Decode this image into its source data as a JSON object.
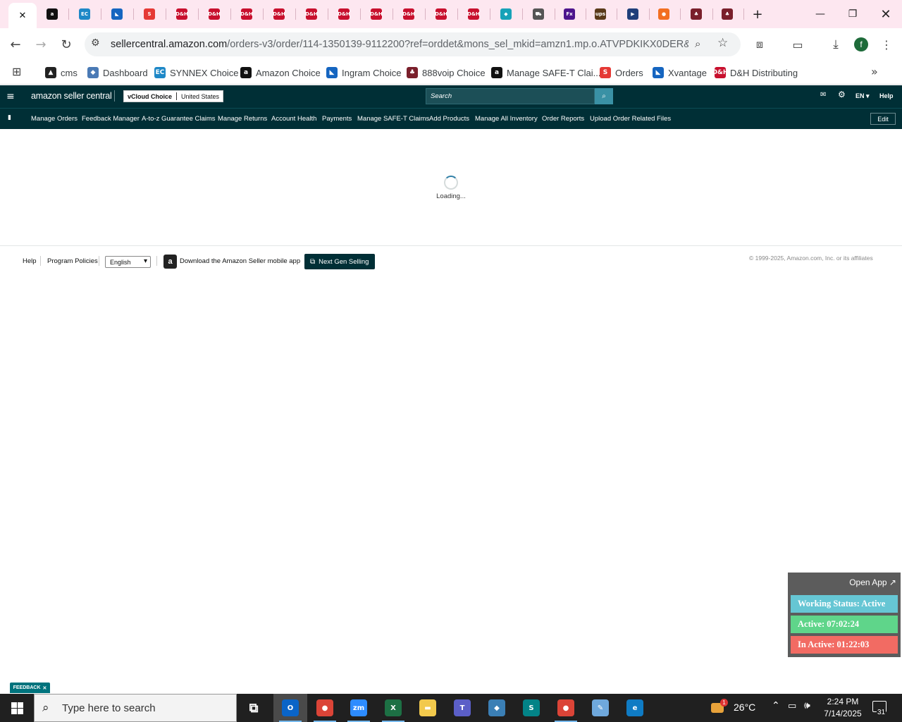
{
  "browser": {
    "tabs": [
      {
        "icon": "amazon-icon",
        "color": "#111111",
        "glyph": "a"
      },
      {
        "icon": "ec-icon",
        "color": "#1e88c7",
        "glyph": "EC"
      },
      {
        "icon": "swoosh-icon",
        "color": "#1565c0",
        "glyph": "◣"
      },
      {
        "icon": "s-logo-icon",
        "color": "#e53935",
        "glyph": "S"
      },
      {
        "icon": "dh-icon",
        "color": "#c8102e",
        "glyph": "D&H"
      },
      {
        "icon": "dh-icon",
        "color": "#c8102e",
        "glyph": "D&H"
      },
      {
        "icon": "dh-icon",
        "color": "#c8102e",
        "glyph": "D&H"
      },
      {
        "icon": "dh-icon",
        "color": "#c8102e",
        "glyph": "D&H"
      },
      {
        "icon": "dh-icon",
        "color": "#c8102e",
        "glyph": "D&H"
      },
      {
        "icon": "dh-icon",
        "color": "#c8102e",
        "glyph": "D&H"
      },
      {
        "icon": "dh-icon",
        "color": "#c8102e",
        "glyph": "D&H"
      },
      {
        "icon": "dh-icon",
        "color": "#c8102e",
        "glyph": "D&H"
      },
      {
        "icon": "dh-icon",
        "color": "#c8102e",
        "glyph": "D&H"
      },
      {
        "icon": "dh-icon",
        "color": "#c8102e",
        "glyph": "D&H"
      },
      {
        "icon": "diamond-icon",
        "color": "#17a2b8",
        "glyph": "◆"
      },
      {
        "icon": "truck-icon",
        "color": "#555555",
        "glyph": "⛟"
      },
      {
        "icon": "fedex-icon",
        "color": "#4d148c",
        "glyph": "Fx"
      },
      {
        "icon": "ups-icon",
        "color": "#5a3a1a",
        "glyph": "ups"
      },
      {
        "icon": "usps-icon",
        "color": "#1f3f7a",
        "glyph": "▶"
      },
      {
        "icon": "orange-circle-icon",
        "color": "#f26f21",
        "glyph": "●"
      },
      {
        "icon": "voip-icon",
        "color": "#7a1f2b",
        "glyph": "♣"
      },
      {
        "icon": "voip-icon",
        "color": "#7a1f2b",
        "glyph": "♣"
      }
    ],
    "url_host": "sellercentral.amazon.com",
    "url_path": "/orders-v3/order/114-1350139-9112200?ref=orddet&mons_sel_mkid=amzn1.mp.o.ATVPDKIKX0DER&mo...",
    "profile_initial": "f",
    "bookmarks": [
      {
        "label": "cms",
        "icon": "cms-icon",
        "color": "#222222",
        "glyph": "▲"
      },
      {
        "label": "Dashboard",
        "icon": "dashboard-icon",
        "color": "#4a7ab5",
        "glyph": "◆"
      },
      {
        "label": "SYNNEX Choice",
        "icon": "ec-icon",
        "color": "#1e88c7",
        "glyph": "EC"
      },
      {
        "label": "Amazon Choice",
        "icon": "amazon-icon",
        "color": "#111111",
        "glyph": "a"
      },
      {
        "label": "Ingram Choice",
        "icon": "swoosh-icon",
        "color": "#1565c0",
        "glyph": "◣"
      },
      {
        "label": "888voip Choice",
        "icon": "voip-icon",
        "color": "#7a1f2b",
        "glyph": "♣"
      },
      {
        "label": "Manage SAFE-T Clai...",
        "icon": "amazon-icon",
        "color": "#111111",
        "glyph": "a"
      },
      {
        "label": "Orders",
        "icon": "s-logo-icon",
        "color": "#e53935",
        "glyph": "S"
      },
      {
        "label": "Xvantage",
        "icon": "swoosh-icon",
        "color": "#1565c0",
        "glyph": "◣"
      },
      {
        "label": "D&H Distributing",
        "icon": "dh-icon",
        "color": "#c8102e",
        "glyph": "D&H"
      }
    ]
  },
  "seller_central": {
    "logo": "amazon seller central",
    "store": "vCloud Choice",
    "marketplace": "United States",
    "search_placeholder": "Search",
    "language": "EN",
    "help": "Help",
    "nav": [
      "Manage Orders",
      "Feedback Manager",
      "A-to-z Guarantee Claims",
      "Manage Returns",
      "Account Health",
      "Payments",
      "Manage SAFE-T Claims",
      "Add Products",
      "Manage All Inventory",
      "Order Reports",
      "Upload Order Related Files"
    ],
    "edit": "Edit",
    "loading": "Loading..."
  },
  "footer": {
    "help": "Help",
    "program_policies": "Program Policies",
    "language": "English",
    "mobile_app": "Download the Amazon Seller mobile app",
    "next_gen": "Next Gen Selling",
    "copyright": "© 1999-2025, Amazon.com, Inc. or its affiliates"
  },
  "widget": {
    "open_app": "Open App ↗",
    "status": "Working Status: Active",
    "active": "Active: 07:02:24",
    "inactive": "In Active: 01:22:03",
    "colors": {
      "status": "#66c6d4",
      "active": "#5fd58a",
      "inactive": "#f26b63"
    }
  },
  "feedback": "FEEDBACK",
  "taskbar": {
    "search_placeholder": "Type here to search",
    "apps": [
      {
        "icon": "task-view-icon",
        "color": "#202020",
        "glyph": "⧉"
      },
      {
        "icon": "outlook-icon",
        "color": "#0a64c7",
        "glyph": "O"
      },
      {
        "icon": "chrome-icon",
        "color": "#db4437",
        "glyph": "●"
      },
      {
        "icon": "zoom-icon",
        "color": "#2d8cff",
        "glyph": "zm"
      },
      {
        "icon": "excel-icon",
        "color": "#1d7044",
        "glyph": "X"
      },
      {
        "icon": "file-explorer-icon",
        "color": "#f2c94c",
        "glyph": "▬"
      },
      {
        "icon": "teams-icon",
        "color": "#5b5fc7",
        "glyph": "T"
      },
      {
        "icon": "app-diamond-icon",
        "color": "#3b7fb5",
        "glyph": "◆"
      },
      {
        "icon": "sharepoint-icon",
        "color": "#038387",
        "glyph": "S"
      },
      {
        "icon": "chrome-profile-icon",
        "color": "#db4437",
        "glyph": "●"
      },
      {
        "icon": "notepad-icon",
        "color": "#6fa8dc",
        "glyph": "✎"
      },
      {
        "icon": "edge-icon",
        "color": "#0f7bc4",
        "glyph": "e"
      }
    ],
    "weather": "26°C",
    "weather_badge": "1",
    "time": "2:24 PM",
    "date": "7/14/2025",
    "notifications": "31"
  }
}
